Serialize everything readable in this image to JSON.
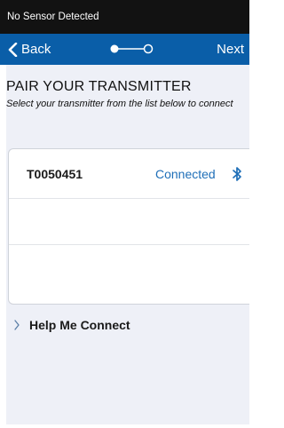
{
  "status_bar": {
    "text": "No Sensor Detected"
  },
  "nav_bar": {
    "back_label": "Back",
    "next_label": "Next",
    "colors": {
      "background": "#0a5ea8",
      "text": "#ffffff"
    },
    "step_indicator": {
      "total_steps": 2,
      "current_step": 1
    }
  },
  "page": {
    "title": "PAIR YOUR TRANSMITTER",
    "subtitle": "Select your transmitter from the list below to connect"
  },
  "transmitter_list": {
    "items": [
      {
        "id": "T0050451",
        "status": "Connected",
        "icon": "bluetooth-icon"
      }
    ],
    "empty_rows": 2,
    "status_color": "#1f6fb8"
  },
  "help": {
    "label": "Help Me Connect",
    "icon": "chevron-right-icon"
  }
}
